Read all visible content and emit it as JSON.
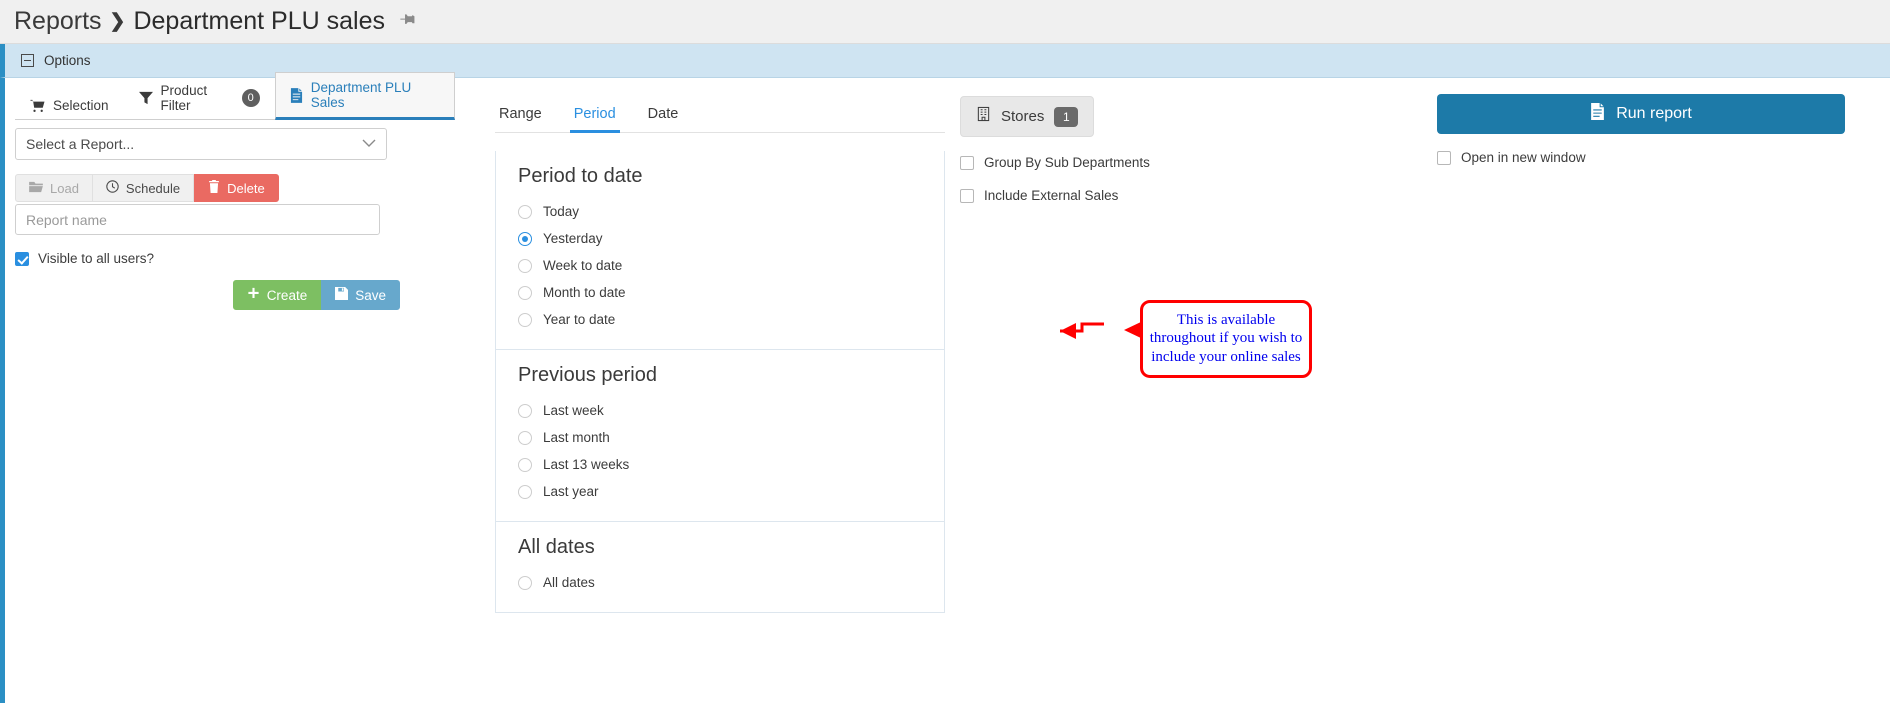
{
  "header": {
    "breadcrumb_root": "Reports",
    "breadcrumb_separator": "❯",
    "page_title": "Department PLU sales",
    "pin_icon": "pin-icon"
  },
  "options_bar": {
    "label": "Options",
    "collapse_icon": "minus-square-icon"
  },
  "left_panel": {
    "tabs": [
      {
        "label": "Selection",
        "icon": "shopping-cart-icon",
        "active": false,
        "badge": null
      },
      {
        "label": "Product Filter",
        "icon": "funnel-icon",
        "active": false,
        "badge": "0"
      },
      {
        "label": "Department PLU Sales",
        "icon": "document-icon",
        "active": true,
        "badge": null
      }
    ],
    "report_select": {
      "value": "Select a Report...",
      "chevron_icon": "chevron-down-icon"
    },
    "buttons": [
      {
        "label": "Load",
        "icon": "folder-open-icon",
        "state": "disabled"
      },
      {
        "label": "Schedule",
        "icon": "clock-icon",
        "state": "default"
      },
      {
        "label": "Delete",
        "icon": "trash-icon",
        "state": "danger"
      }
    ],
    "report_name": {
      "value": "",
      "placeholder": "Report name"
    },
    "visible_to_all": {
      "label": "Visible to all users?",
      "checked": true
    },
    "create_label": "Create",
    "create_icon": "plus-icon",
    "save_label": "Save",
    "save_icon": "floppy-disk-icon"
  },
  "period_panel": {
    "subtabs": [
      {
        "label": "Range",
        "active": false
      },
      {
        "label": "Period",
        "active": true
      },
      {
        "label": "Date",
        "active": false
      }
    ],
    "groups": [
      {
        "title": "Period to date",
        "options": [
          {
            "label": "Today",
            "selected": false
          },
          {
            "label": "Yesterday",
            "selected": true
          },
          {
            "label": "Week to date",
            "selected": false
          },
          {
            "label": "Month to date",
            "selected": false
          },
          {
            "label": "Year to date",
            "selected": false
          }
        ]
      },
      {
        "title": "Previous period",
        "options": [
          {
            "label": "Last week",
            "selected": false
          },
          {
            "label": "Last month",
            "selected": false
          },
          {
            "label": "Last 13 weeks",
            "selected": false
          },
          {
            "label": "Last year",
            "selected": false
          }
        ]
      },
      {
        "title": "All dates",
        "options": [
          {
            "label": "All dates",
            "selected": false
          }
        ]
      }
    ]
  },
  "stores_panel": {
    "stores_button": {
      "label": "Stores",
      "icon": "building-icon",
      "badge": "1"
    },
    "checkboxes": [
      {
        "label": "Group By Sub Departments",
        "checked": false
      },
      {
        "label": "Include External Sales",
        "checked": false
      }
    ]
  },
  "annotation": {
    "text": "This is available throughout if you wish to include your online sales",
    "border_color": "#ff0000",
    "text_color": "#0000ee"
  },
  "run_panel": {
    "run_label": "Run report",
    "run_icon": "document-icon",
    "open_new_window": {
      "label": "Open in new window",
      "checked": false
    },
    "accent_color": "#1d7aa8"
  }
}
